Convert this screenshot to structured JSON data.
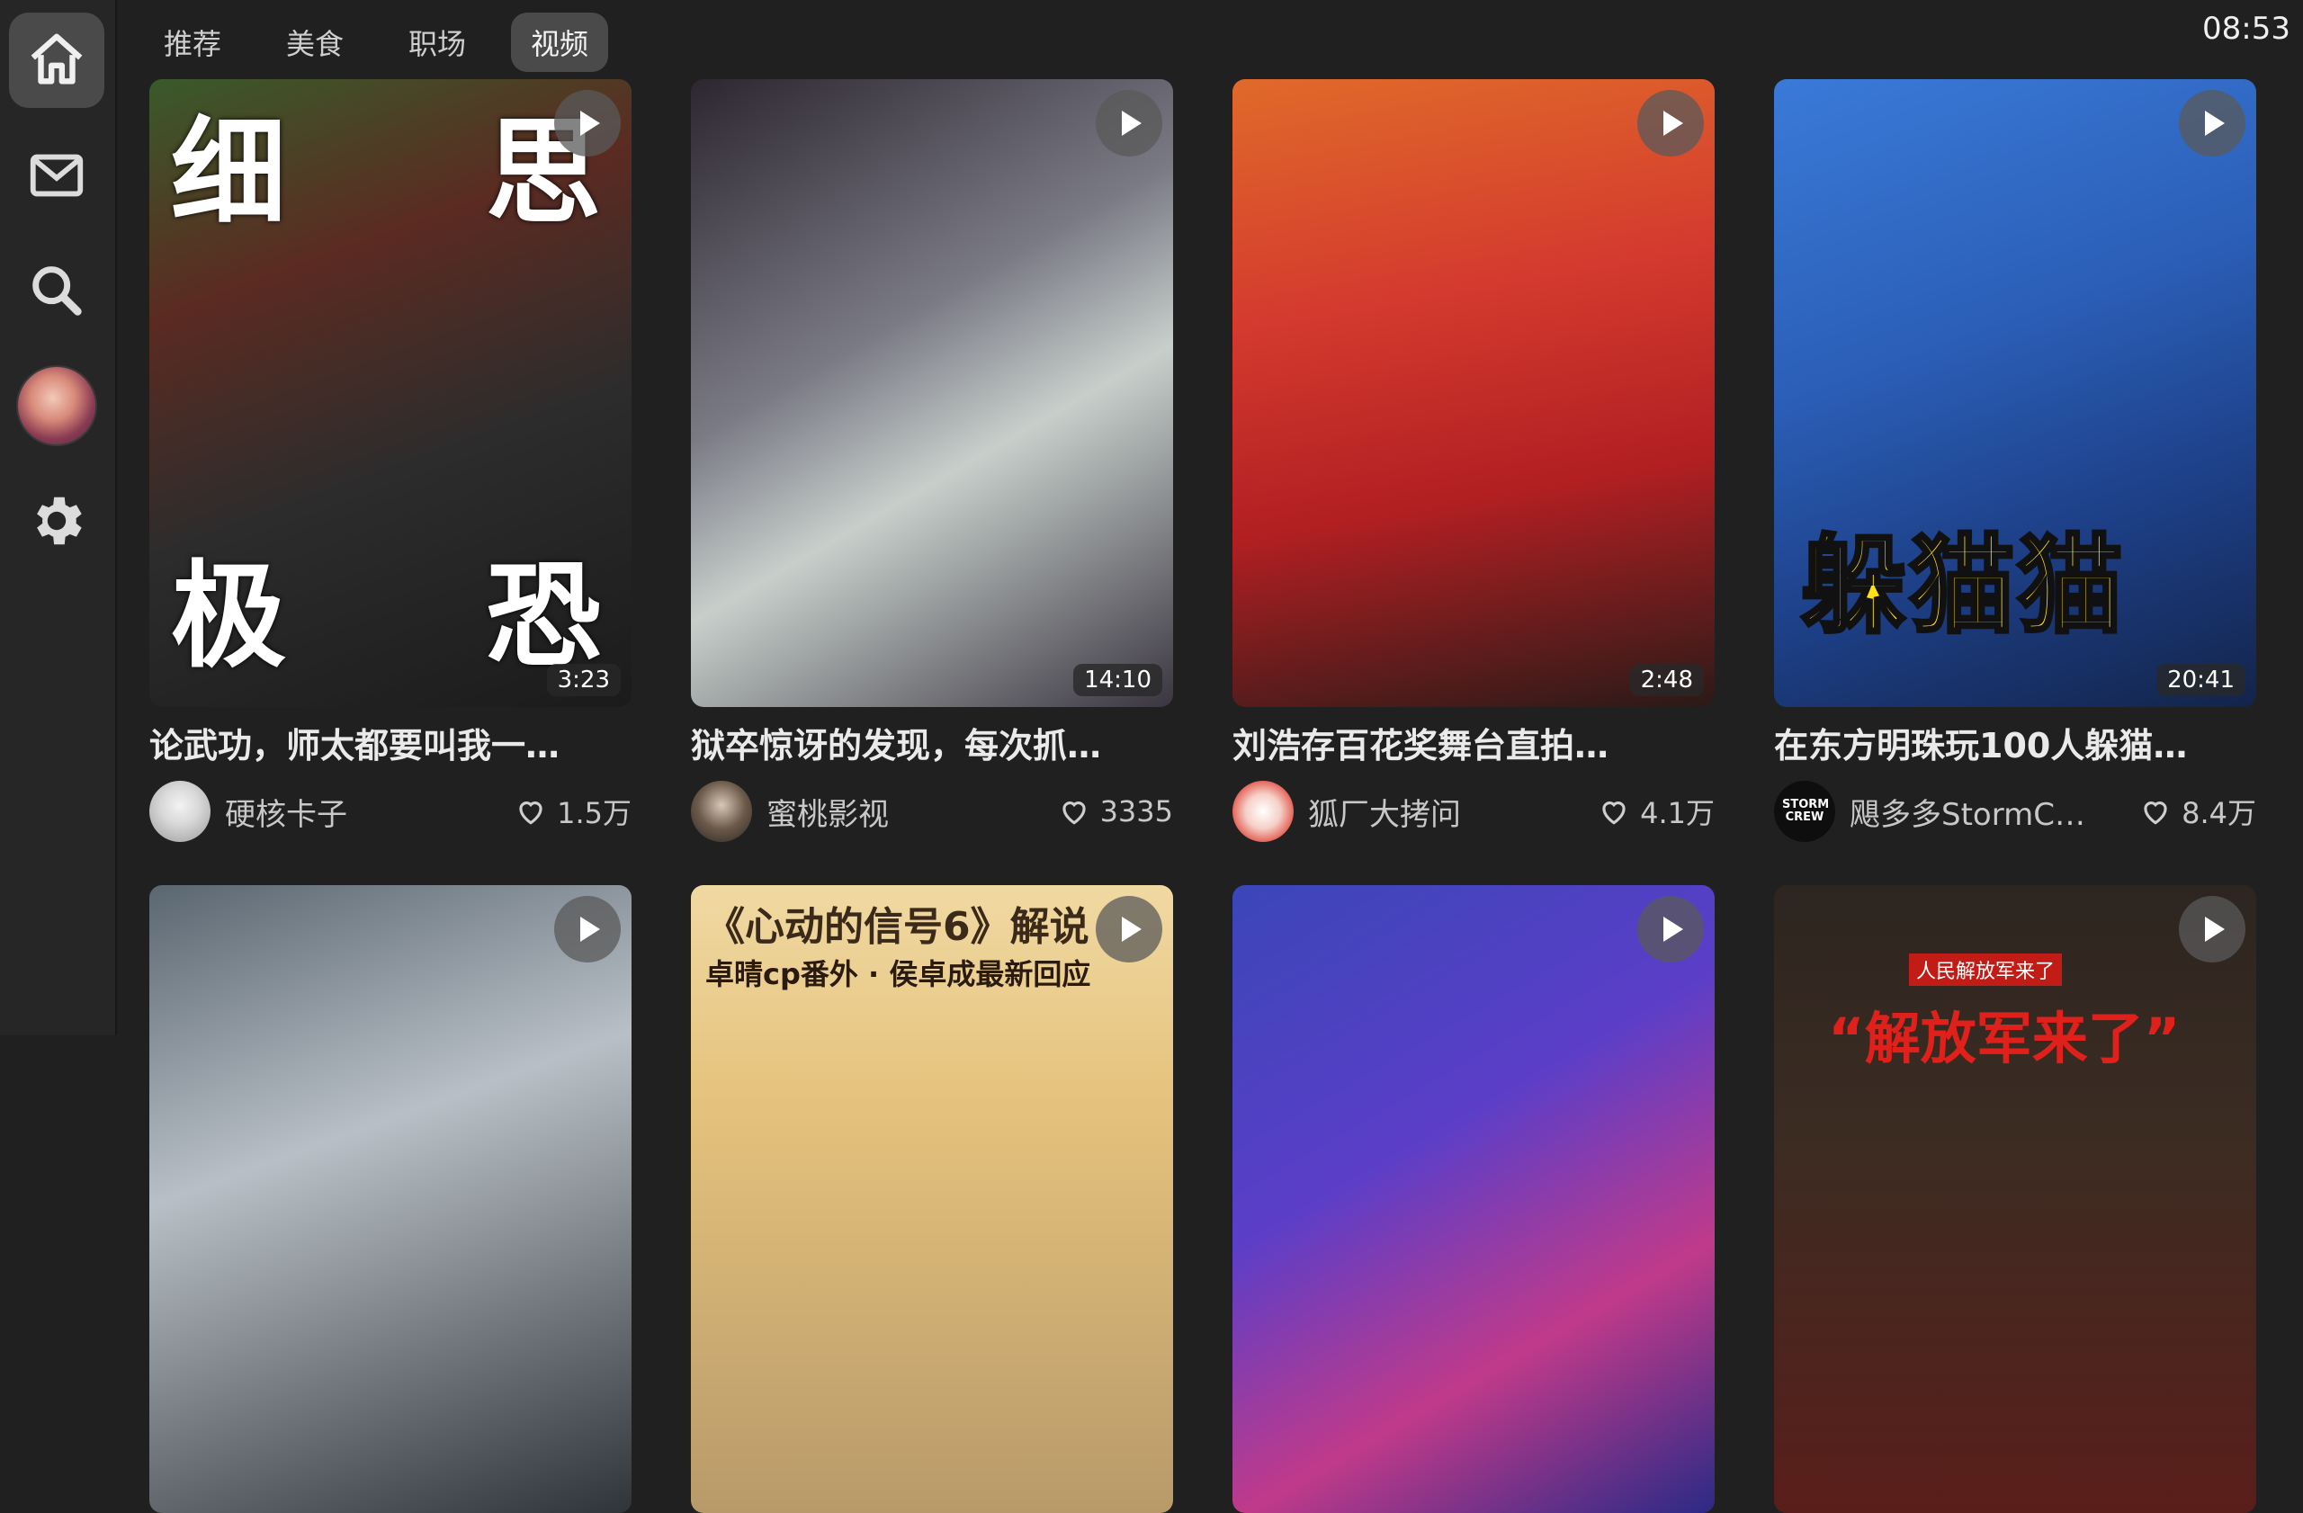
{
  "sidebar": {
    "items": [
      {
        "icon": "home-icon",
        "active": true
      },
      {
        "icon": "mail-icon",
        "active": false
      },
      {
        "icon": "search-icon",
        "active": false
      },
      {
        "icon": "avatar",
        "active": false
      },
      {
        "icon": "gear-icon",
        "active": false
      }
    ]
  },
  "tabs": [
    {
      "label": "推荐"
    },
    {
      "label": "美食"
    },
    {
      "label": "职场"
    },
    {
      "label": "视频",
      "active": true
    }
  ],
  "clock": "08:53",
  "cards": [
    {
      "title": "论武功，师太都要叫我一…",
      "author": "硬核卡子",
      "likes": "1.5万",
      "duration": "3:23",
      "overlay": [
        "细",
        "思",
        "极",
        "恐"
      ]
    },
    {
      "title": "狱卒惊讶的发现，每次抓…",
      "author": "蜜桃影视",
      "likes": "3335",
      "duration": "14:10"
    },
    {
      "title": "刘浩存百花奖舞台直拍…",
      "author": "狐厂大拷问",
      "likes": "4.1万",
      "duration": "2:48"
    },
    {
      "title": "在东方明珠玩100人躲猫…",
      "author": "飓多多StormC…",
      "likes": "8.4万",
      "duration": "20:41",
      "overlay_big": "躲猫猫",
      "avatar_text": "STORM CREW"
    },
    {
      "title": "",
      "author": "",
      "likes": "",
      "duration": ""
    },
    {
      "title": "",
      "author": "",
      "likes": "",
      "duration": "",
      "overlay_top": "《心动的信号6》解说",
      "overlay_sub": "卓晴cp番外 · 侯卓成最新回应"
    },
    {
      "title": "",
      "author": "",
      "likes": "",
      "duration": ""
    },
    {
      "title": "",
      "author": "",
      "likes": "",
      "duration": "",
      "overlay_sign": "人民解放军来了",
      "overlay_banner": "“解放军来了”"
    }
  ],
  "colors": {
    "background": "#202020",
    "sidebar": "#262626",
    "active": "#4a4a4a",
    "accent_yellow": "#ffe11a"
  }
}
